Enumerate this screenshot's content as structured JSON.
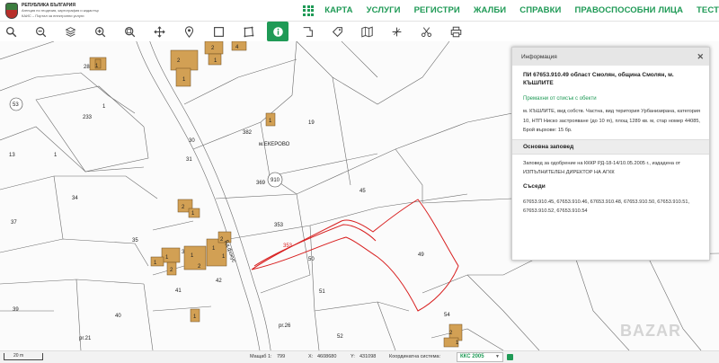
{
  "header": {
    "logo_title": "РЕПУБЛИКА БЪЛГАРИЯ",
    "logo_lines": [
      "Агенция по геодезия, картография и кадастър",
      "КАИС – Портал за електронни услуги"
    ],
    "nav": [
      "КАРТА",
      "УСЛУГИ",
      "РЕГИСТРИ",
      "ЖАЛБИ",
      "СПРАВКИ",
      "ПРАВОСПОСОБНИ ЛИЦА",
      "ТЕСТ"
    ]
  },
  "toolbar": {
    "tools": [
      "search-icon",
      "zoom-out-icon",
      "layers-icon",
      "zoom-in-icon",
      "zoom-extent-icon",
      "pan-icon",
      "location-pin-icon",
      "rectangle-select-icon",
      "polygon-select-icon",
      "info-icon",
      "parcel-boundary-icon",
      "tag-icon",
      "map-icon",
      "measure-icon",
      "scissors-icon",
      "print-icon"
    ],
    "active": "info-icon"
  },
  "map": {
    "labels": [
      "1",
      "2",
      "1",
      "2",
      "1",
      "1",
      "2",
      "1",
      "1",
      "2",
      "1",
      "2",
      "1",
      "2",
      "1",
      "3",
      "1",
      "1",
      "2",
      "1",
      "4",
      "1",
      "1",
      "53",
      "233",
      "28",
      "34",
      "37",
      "13",
      "35",
      "30",
      "31",
      "382",
      "м.ЕКЕРОВО",
      "369",
      "910",
      "353",
      "19",
      "45",
      "49",
      "50",
      "51",
      "52",
      "40",
      "41",
      "42",
      "54",
      "39",
      "pr.21",
      "pr.26",
      "Бд.фокус"
    ]
  },
  "info_panel": {
    "header": "Информация",
    "close": "✕",
    "title": "ПИ 67653.910.49 област Смолян, община Смолян, м. КЪШЛИТЕ",
    "link": "Премахни от списък с обекти",
    "description": "м. КЪШЛИТЕ, вид собств. Частна, вид територия Урбанизирана, категория 10, НТП Ниско застрояване (до 10 m), площ 1289 кв. м, стар номер 44085, Брой върхове: 15 бр.",
    "order_header": "Основна заповед",
    "order_text": "Заповед за одобрение на КККР РД-18-14/10.05.2005 г., издадена от ИЗПЪЛНИТЕЛЕН ДИРЕКТОР НА АГКК",
    "neighbors_header": "Съседи",
    "neighbors": "67653.910.45, 67653.910.46, 67653.910.48, 67653.910.50, 67653.910.51, 67653.910.52, 67653.910.54"
  },
  "status_bar": {
    "scale_text": "20 m",
    "scale_label": "Мащаб 1:",
    "scale_value": "799",
    "x_label": "X:",
    "x_value": "4608680",
    "y_label": "Y:",
    "y_value": "431098",
    "crs_label": "Координатна система:",
    "crs_value": "ККС 2005"
  },
  "watermark": "BAZAR"
}
